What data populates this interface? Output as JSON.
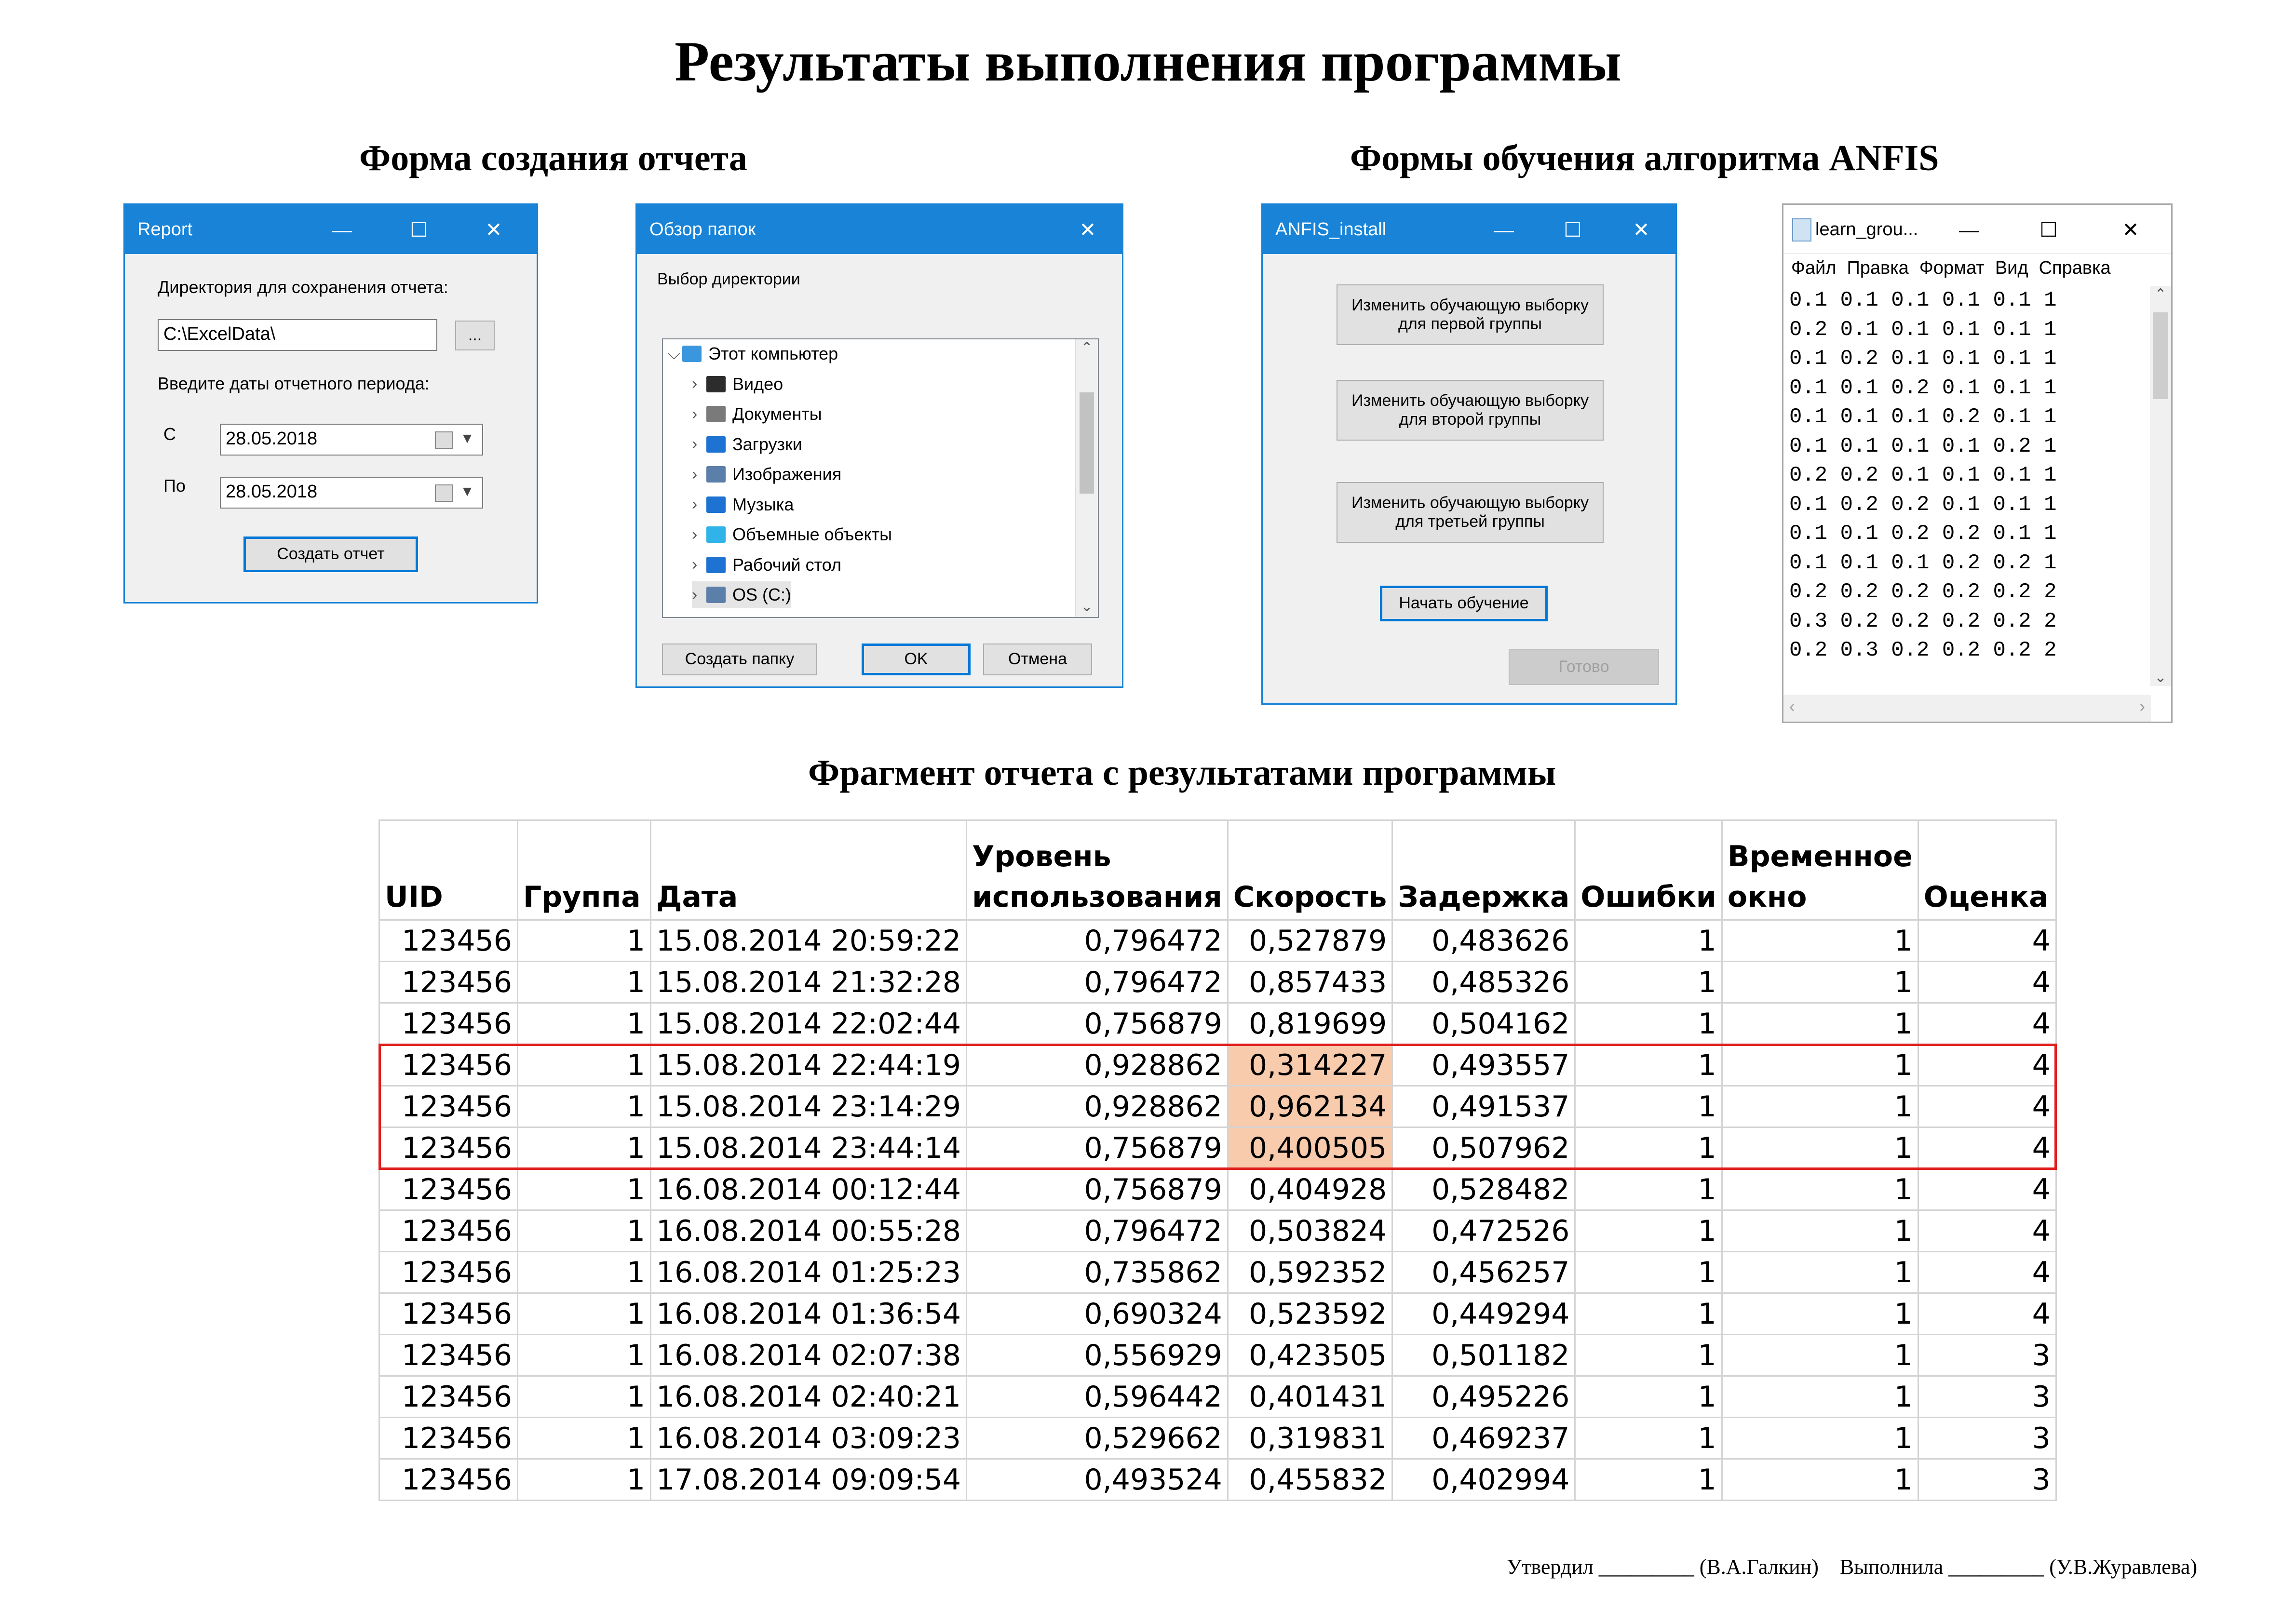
{
  "page_title": "Результаты выполнения программы",
  "sections": {
    "report_form": "Форма создания отчета",
    "anfis_forms": "Формы обучения алгоритма ANFIS",
    "report_fragment": "Фрагмент отчета с результатами программы"
  },
  "report_window": {
    "title": "Report",
    "dir_label": "Директория для сохранения отчета:",
    "dir_value": "C:\\ExcelData\\",
    "browse_label": "...",
    "period_label": "Введите даты отчетного периода:",
    "from_label": "С",
    "from_value": "28.05.2018",
    "to_label": "По",
    "to_value": "28.05.2018",
    "create_button": "Создать отчет"
  },
  "folder_dialog": {
    "title": "Обзор папок",
    "prompt": "Выбор директории",
    "tree": [
      {
        "label": "Этот компьютер",
        "icon": "computer-icon",
        "color": "#3a96dd"
      },
      {
        "label": "Видео",
        "icon": "video-icon",
        "color": "#2c2c2c"
      },
      {
        "label": "Документы",
        "icon": "documents-icon",
        "color": "#7a7a7a"
      },
      {
        "label": "Загрузки",
        "icon": "downloads-icon",
        "color": "#1e73d2"
      },
      {
        "label": "Изображения",
        "icon": "images-icon",
        "color": "#5b7fa8"
      },
      {
        "label": "Музыка",
        "icon": "music-icon",
        "color": "#1e73d2"
      },
      {
        "label": "Объемные объекты",
        "icon": "3d-objects-icon",
        "color": "#2fb3e8"
      },
      {
        "label": "Рабочий стол",
        "icon": "desktop-icon",
        "color": "#1e73d2"
      },
      {
        "label": "OS (C:)",
        "icon": "drive-icon",
        "color": "#5b7fa8"
      }
    ],
    "new_folder_button": "Создать папку",
    "ok_button": "OK",
    "cancel_button": "Отмена"
  },
  "anfis_window": {
    "title": "ANFIS_install",
    "group1_line1": "Изменить обучающую выборку",
    "group1_line2": "для первой группы",
    "group2_line1": "Изменить обучающую выборку",
    "group2_line2": "для второй группы",
    "group3_line1": "Изменить обучающую выборку",
    "group3_line2": "для третьей группы",
    "start_button": "Начать обучение",
    "done_button": "Готово"
  },
  "notepad": {
    "title": "learn_grou...",
    "menu": [
      "Файл",
      "Правка",
      "Формат",
      "Вид",
      "Справка"
    ],
    "lines": [
      "0.1 0.1 0.1 0.1 0.1 1",
      "0.2 0.1 0.1 0.1 0.1 1",
      "0.1 0.2 0.1 0.1 0.1 1",
      "0.1 0.1 0.2 0.1 0.1 1",
      "0.1 0.1 0.1 0.2 0.1 1",
      "0.1 0.1 0.1 0.1 0.2 1",
      "0.2 0.2 0.1 0.1 0.1 1",
      "0.1 0.2 0.2 0.1 0.1 1",
      "0.1 0.1 0.2 0.2 0.1 1",
      "0.1 0.1 0.1 0.2 0.2 1",
      "0.2 0.2 0.2 0.2 0.2 2",
      "0.3 0.2 0.2 0.2 0.2 2",
      "0.2 0.3 0.2 0.2 0.2 2"
    ]
  },
  "report_table": {
    "headers": [
      [
        "UID"
      ],
      [
        "Группа"
      ],
      [
        "Дата"
      ],
      [
        "Уровень",
        "использования"
      ],
      [
        "Скорость"
      ],
      [
        "Задержка"
      ],
      [
        "Ошибки"
      ],
      [
        "Временное",
        "окно"
      ],
      [
        "Оценка"
      ]
    ],
    "rows": [
      [
        "123456",
        "1",
        "15.08.2014 20:59:22",
        "0,796472",
        "0,527879",
        "0,483626",
        "1",
        "1",
        "4"
      ],
      [
        "123456",
        "1",
        "15.08.2014 21:32:28",
        "0,796472",
        "0,857433",
        "0,485326",
        "1",
        "1",
        "4"
      ],
      [
        "123456",
        "1",
        "15.08.2014 22:02:44",
        "0,756879",
        "0,819699",
        "0,504162",
        "1",
        "1",
        "4"
      ],
      [
        "123456",
        "1",
        "15.08.2014 22:44:19",
        "0,928862",
        "0,314227",
        "0,493557",
        "1",
        "1",
        "4"
      ],
      [
        "123456",
        "1",
        "15.08.2014 23:14:29",
        "0,928862",
        "0,962134",
        "0,491537",
        "1",
        "1",
        "4"
      ],
      [
        "123456",
        "1",
        "15.08.2014 23:44:14",
        "0,756879",
        "0,400505",
        "0,507962",
        "1",
        "1",
        "4"
      ],
      [
        "123456",
        "1",
        "16.08.2014 00:12:44",
        "0,756879",
        "0,404928",
        "0,528482",
        "1",
        "1",
        "4"
      ],
      [
        "123456",
        "1",
        "16.08.2014 00:55:28",
        "0,796472",
        "0,503824",
        "0,472526",
        "1",
        "1",
        "4"
      ],
      [
        "123456",
        "1",
        "16.08.2014 01:25:23",
        "0,735862",
        "0,592352",
        "0,456257",
        "1",
        "1",
        "4"
      ],
      [
        "123456",
        "1",
        "16.08.2014 01:36:54",
        "0,690324",
        "0,523592",
        "0,449294",
        "1",
        "1",
        "4"
      ],
      [
        "123456",
        "1",
        "16.08.2014 02:07:38",
        "0,556929",
        "0,423505",
        "0,501182",
        "1",
        "1",
        "3"
      ],
      [
        "123456",
        "1",
        "16.08.2014 02:40:21",
        "0,596442",
        "0,401431",
        "0,495226",
        "1",
        "1",
        "3"
      ],
      [
        "123456",
        "1",
        "16.08.2014 03:09:23",
        "0,529662",
        "0,319831",
        "0,469237",
        "1",
        "1",
        "3"
      ],
      [
        "123456",
        "1",
        "17.08.2014 09:09:54",
        "0,493524",
        "0,455832",
        "0,402994",
        "1",
        "1",
        "3"
      ]
    ],
    "highlighted_rows": [
      3,
      4,
      5
    ],
    "highlight_color": "#f8cbad",
    "outline_color": "#e0201f"
  },
  "footer": {
    "approved": "Утвердил _________ (В.А.Галкин)",
    "performed": "Выполнила _________ (У.В.Журавлева)"
  }
}
